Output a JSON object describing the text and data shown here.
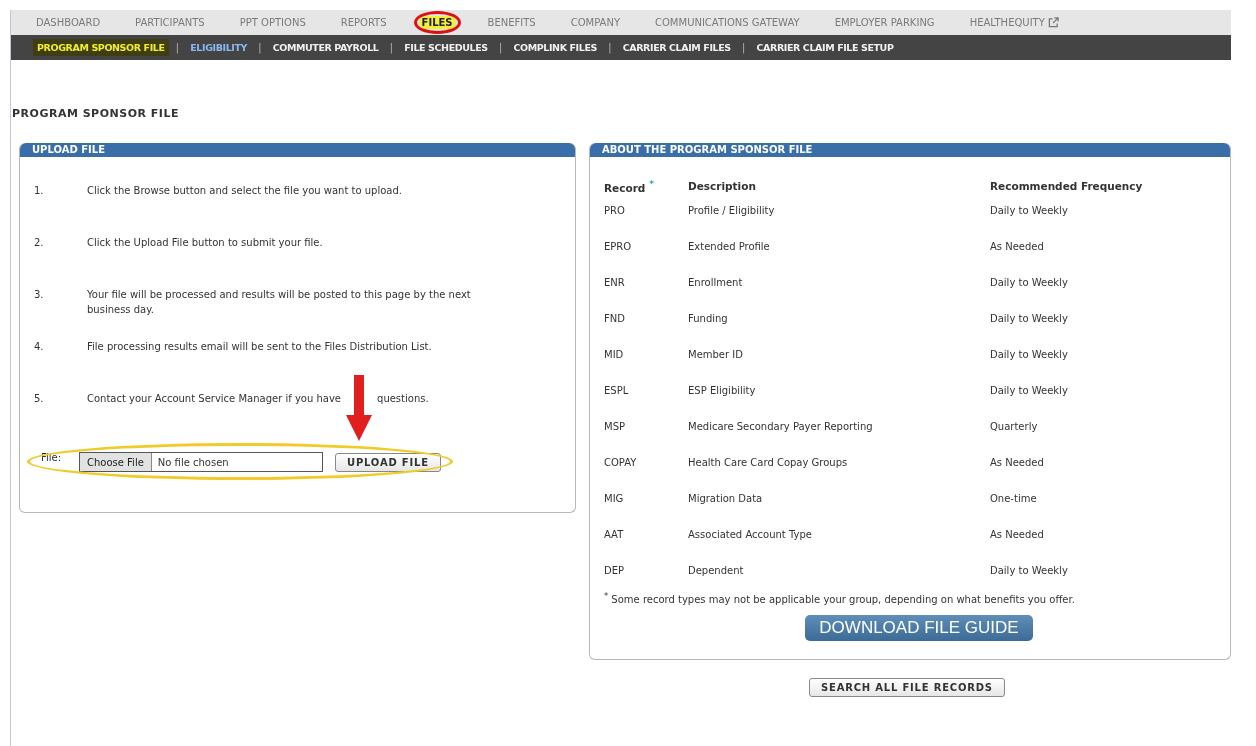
{
  "top_nav": [
    {
      "label": "DASHBOARD",
      "selected": false,
      "circled": false
    },
    {
      "label": "PARTICIPANTS",
      "selected": false,
      "circled": false
    },
    {
      "label": "PPT OPTIONS",
      "selected": false,
      "circled": false
    },
    {
      "label": "REPORTS",
      "selected": false,
      "circled": false
    },
    {
      "label": "FILES",
      "selected": true,
      "circled": true
    },
    {
      "label": "BENEFITS",
      "selected": false,
      "circled": false
    },
    {
      "label": "COMPANY",
      "selected": false,
      "circled": false
    },
    {
      "label": "COMMUNICATIONS GATEWAY",
      "selected": false,
      "circled": false
    },
    {
      "label": "EMPLOYER PARKING",
      "selected": false,
      "circled": false
    },
    {
      "label": "HEALTHEQUITY",
      "selected": false,
      "circled": false,
      "external": true
    }
  ],
  "sub_nav": [
    {
      "label": "PROGRAM SPONSOR FILE",
      "selected": true,
      "highlighted": false
    },
    {
      "label": "ELIGIBILITY",
      "selected": false,
      "highlighted": true
    },
    {
      "label": "COMMUTER PAYROLL",
      "selected": false,
      "highlighted": false
    },
    {
      "label": "FILE SCHEDULES",
      "selected": false,
      "highlighted": false
    },
    {
      "label": "COMPLINK FILES",
      "selected": false,
      "highlighted": false
    },
    {
      "label": "CARRIER CLAIM FILES",
      "selected": false,
      "highlighted": false
    },
    {
      "label": "CARRIER CLAIM FILE SETUP",
      "selected": false,
      "highlighted": false
    }
  ],
  "sub_nav_separator": "|",
  "page_title": "PROGRAM SPONSOR FILE",
  "upload_panel": {
    "title": "UPLOAD FILE",
    "steps": [
      {
        "number": "1.",
        "text": "Click the Browse button and select the file you want to upload."
      },
      {
        "number": "2.",
        "text": "Click the Upload File button to submit your file."
      },
      {
        "number": "3.",
        "text": "Your file will be processed and results will be posted to this page by the next business day."
      },
      {
        "number": "4.",
        "text": "File processing results email will be sent to the Files Distribution List."
      },
      {
        "number": "5.",
        "text": "Contact your Account Service Manager if you have",
        "text_after": "questions.",
        "pointed": true
      }
    ],
    "file_label": "File:",
    "choose_button": "Choose File",
    "file_status": "No file chosen",
    "upload_button": "UPLOAD FILE",
    "circled": true
  },
  "about_panel": {
    "title": "ABOUT THE PROGRAM SPONSOR FILE",
    "columns": [
      "Record",
      "Description",
      "Recommended Frequency"
    ],
    "record_mark": "*",
    "rows": [
      [
        "PRO",
        "Profile / Eligibility",
        "Daily to Weekly"
      ],
      [
        "EPRO",
        "Extended Profile",
        "As Needed"
      ],
      [
        "ENR",
        "Enrollment",
        "Daily to Weekly"
      ],
      [
        "FND",
        "Funding",
        "Daily to Weekly"
      ],
      [
        "MID",
        "Member ID",
        "Daily to Weekly"
      ],
      [
        "ESPL",
        "ESP Eligibility",
        "Daily to Weekly"
      ],
      [
        "MSP",
        "Medicare Secondary Payer Reporting",
        "Quarterly"
      ],
      [
        "COPAY",
        "Health Care Card Copay Groups",
        "As Needed"
      ],
      [
        "MIG",
        "Migration Data",
        "One-time"
      ],
      [
        "AAT",
        "Associated Account Type",
        "As Needed"
      ],
      [
        "DEP",
        "Dependent",
        "Daily to Weekly"
      ]
    ],
    "footnote": "$^{*}$ Some record types may not be applicable your group, depending on what benefits you offer.",
    "download_button": "DOWNLOAD FILE GUIDE"
  },
  "search_button": "SEARCH ALL FILE RECORDS"
}
